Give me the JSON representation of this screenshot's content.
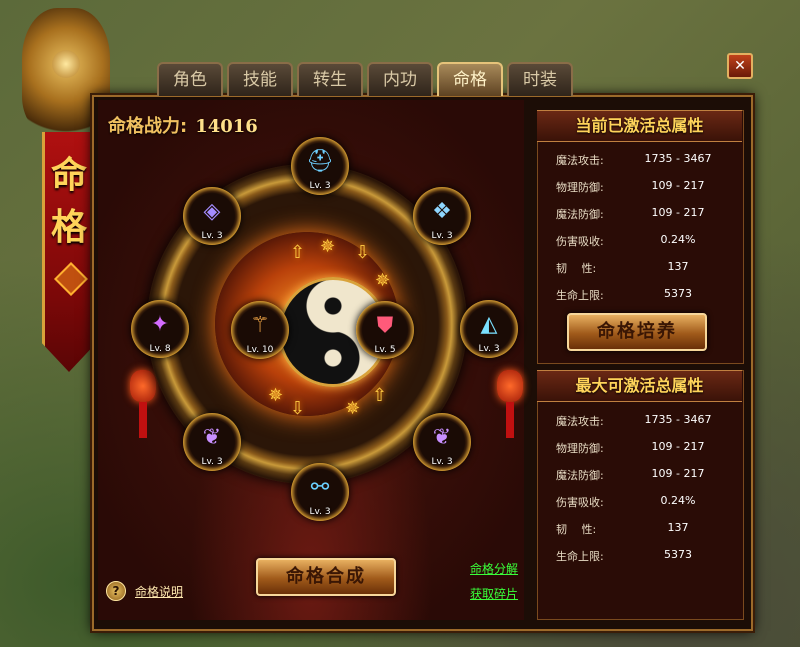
{
  "banner": {
    "chars": [
      "命",
      "格"
    ]
  },
  "tabs": [
    {
      "label": "角色",
      "active": false
    },
    {
      "label": "技能",
      "active": false
    },
    {
      "label": "转生",
      "active": false
    },
    {
      "label": "内功",
      "active": false
    },
    {
      "label": "命格",
      "active": true
    },
    {
      "label": "时装",
      "active": false
    }
  ],
  "close_label": "✕",
  "power": {
    "label": "命格战力:",
    "value": "14016"
  },
  "slots": [
    {
      "name": "helmet",
      "icon": "helmet-icon",
      "glyph": "⛑",
      "color": "#6fd0ff",
      "level": "Lv. 3"
    },
    {
      "name": "amulet",
      "icon": "amulet-icon",
      "glyph": "◈",
      "color": "#a48cff",
      "level": "Lv. 3"
    },
    {
      "name": "shoulder",
      "icon": "shoulder-icon",
      "glyph": "❖",
      "color": "#8fd6ff",
      "level": "Lv. 3"
    },
    {
      "name": "gauntlet",
      "icon": "gauntlet-icon",
      "glyph": "✦",
      "color": "#d46cff",
      "level": "Lv. 8"
    },
    {
      "name": "staff",
      "icon": "staff-icon",
      "glyph": "⚚",
      "color": "#ffb04a",
      "level": "Lv. 10"
    },
    {
      "name": "armor",
      "icon": "armor-icon",
      "glyph": "⛊",
      "color": "#ff5a7a",
      "level": "Lv. 5"
    },
    {
      "name": "boots",
      "icon": "boot-icon",
      "glyph": "◭",
      "color": "#7ae0ff",
      "level": "Lv. 3"
    },
    {
      "name": "ring-left",
      "icon": "ring-icon",
      "glyph": "❦",
      "color": "#c890ff",
      "level": "Lv. 3"
    },
    {
      "name": "ring-right",
      "icon": "ring-icon",
      "glyph": "❦",
      "color": "#c890ff",
      "level": "Lv. 3"
    },
    {
      "name": "leggings",
      "icon": "leggings-icon",
      "glyph": "⚯",
      "color": "#6ad0ff",
      "level": "Lv. 3"
    }
  ],
  "runes": [
    "⇧",
    "✵",
    "⇩",
    "✵",
    "⇧",
    "✵",
    "⇩",
    "✵"
  ],
  "compose_button": "命格合成",
  "help": {
    "icon": "?",
    "label": "命格说明"
  },
  "links": {
    "decompose": "命格分解",
    "obtain": "获取碎片"
  },
  "current_attrs": {
    "title": "当前已激活总属性",
    "rows": [
      {
        "k": "魔法攻击:",
        "v": "1735 - 3467"
      },
      {
        "k": "物理防御:",
        "v": "109 - 217"
      },
      {
        "k": "魔法防御:",
        "v": "109 - 217"
      },
      {
        "k": "伤害吸收:",
        "v": "0.24%"
      },
      {
        "k": "韧　 性:",
        "v": "137"
      },
      {
        "k": "生命上限:",
        "v": "5373"
      }
    ]
  },
  "train_button": "命格培养",
  "max_attrs": {
    "title": "最大可激活总属性",
    "rows": [
      {
        "k": "魔法攻击:",
        "v": "1735 - 3467"
      },
      {
        "k": "物理防御:",
        "v": "109 - 217"
      },
      {
        "k": "魔法防御:",
        "v": "109 - 217"
      },
      {
        "k": "伤害吸收:",
        "v": "0.24%"
      },
      {
        "k": "韧　 性:",
        "v": "137"
      },
      {
        "k": "生命上限:",
        "v": "5373"
      }
    ]
  }
}
